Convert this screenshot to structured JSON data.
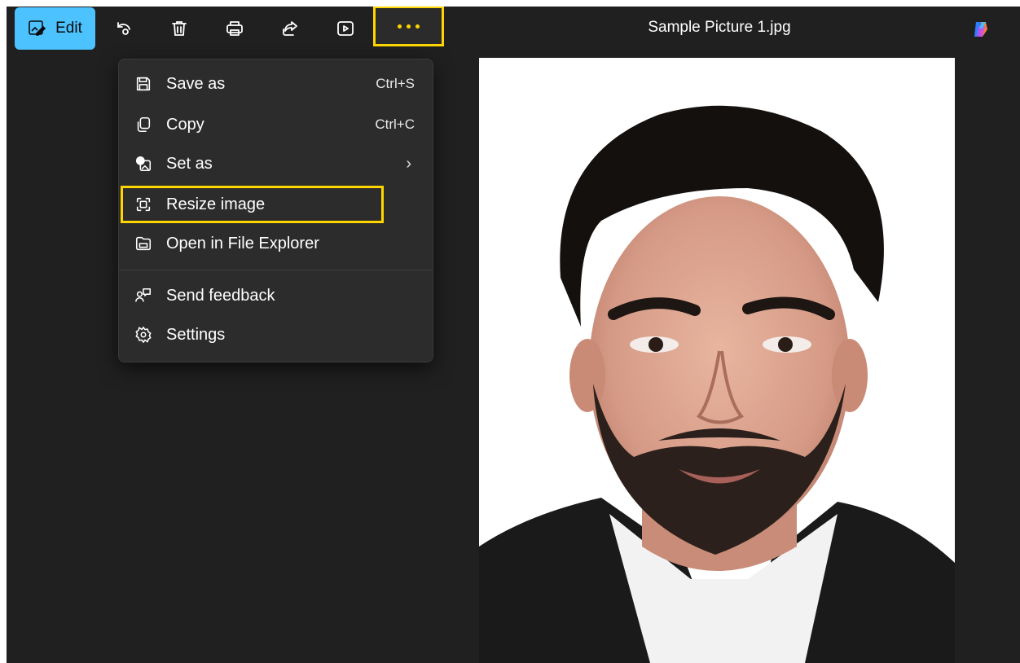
{
  "toolbar": {
    "edit_label": "Edit",
    "icons": [
      "rotate-icon",
      "delete-icon",
      "print-icon",
      "share-icon",
      "slideshow-icon",
      "more-options-icon"
    ],
    "highlight_color": "#ffd500",
    "accent_color": "#4cc2ff"
  },
  "window": {
    "title": "Sample Picture 1.jpg"
  },
  "menu": {
    "items": [
      {
        "label": "Save as",
        "shortcut": "Ctrl+S",
        "icon": "save-icon"
      },
      {
        "label": "Copy",
        "shortcut": "Ctrl+C",
        "icon": "copy-icon"
      },
      {
        "label": "Set as",
        "shortcut": "",
        "icon": "set-as-icon",
        "submenu": true
      },
      {
        "label": "Resize image",
        "shortcut": "",
        "icon": "resize-icon",
        "highlighted": true
      },
      {
        "label": "Open in File Explorer",
        "shortcut": "",
        "icon": "folder-icon"
      },
      {
        "label": "Send feedback",
        "shortcut": "",
        "icon": "feedback-icon"
      },
      {
        "label": "Settings",
        "shortcut": "",
        "icon": "settings-icon"
      }
    ]
  }
}
